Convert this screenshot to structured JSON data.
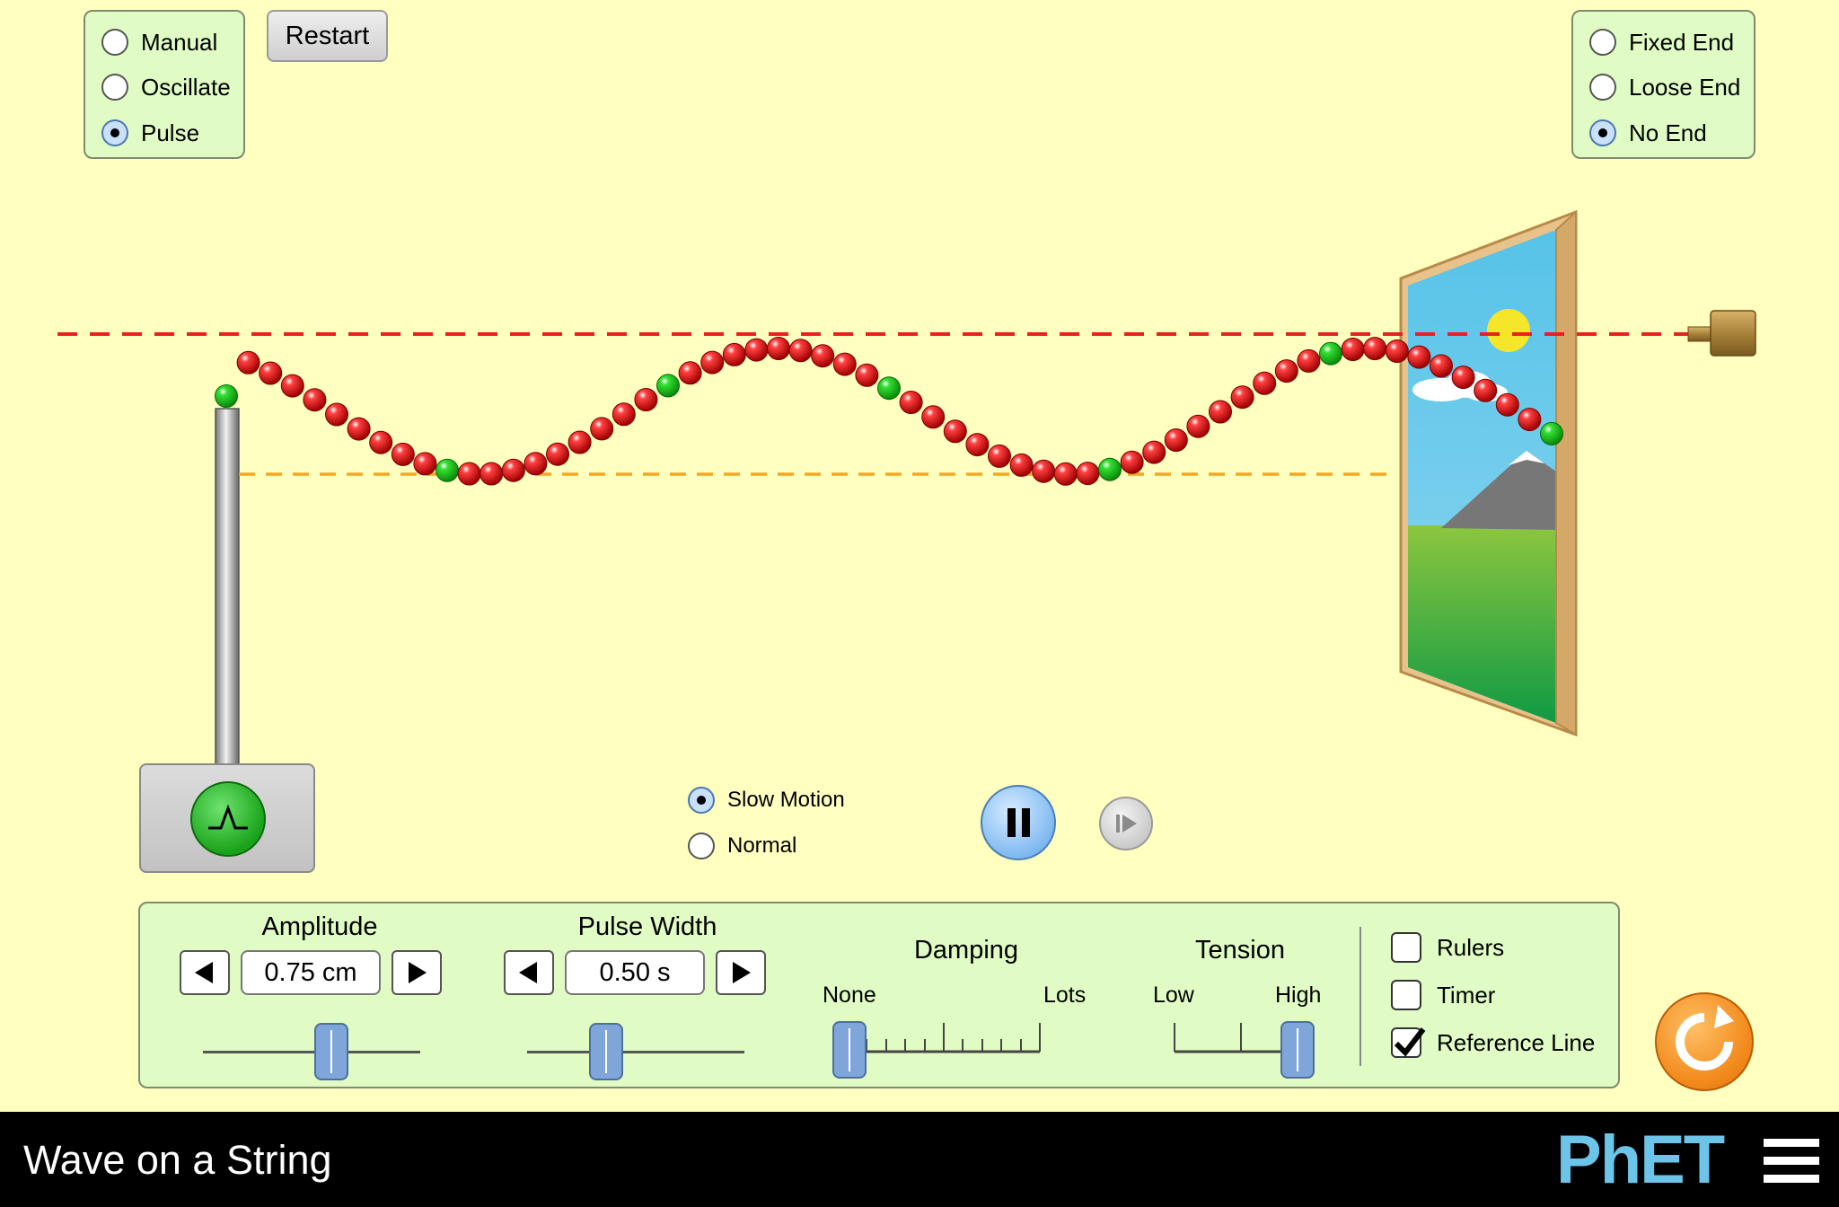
{
  "mode_panel": {
    "options": [
      {
        "label": "Manual",
        "selected": false
      },
      {
        "label": "Oscillate",
        "selected": false
      },
      {
        "label": "Pulse",
        "selected": true
      }
    ]
  },
  "restart_label": "Restart",
  "end_panel": {
    "options": [
      {
        "label": "Fixed End",
        "selected": false
      },
      {
        "label": "Loose End",
        "selected": false
      },
      {
        "label": "No End",
        "selected": true
      }
    ]
  },
  "speed_panel": {
    "options": [
      {
        "label": "Slow Motion",
        "selected": true
      },
      {
        "label": "Normal",
        "selected": false
      }
    ]
  },
  "controls": {
    "amplitude": {
      "label": "Amplitude",
      "value": "0.75 cm"
    },
    "pulse_width": {
      "label": "Pulse Width",
      "value": "0.50 s"
    },
    "damping": {
      "label": "Damping",
      "min_label": "None",
      "max_label": "Lots"
    },
    "tension": {
      "label": "Tension",
      "min_label": "Low",
      "max_label": "High"
    }
  },
  "checkboxes": [
    {
      "label": "Rulers",
      "checked": false
    },
    {
      "label": "Timer",
      "checked": false
    },
    {
      "label": "Reference Line",
      "checked": true
    }
  ],
  "title": "Wave on a String",
  "brand": "PhET",
  "colors": {
    "background": "#ffffc0",
    "panel": "#e0fcc4",
    "bead": "#e80000",
    "bead_marked": "#22cc22",
    "reference_line": "#e82020",
    "orange_line": "#f5a623",
    "reset_button": "#f28a1c",
    "phet_blue": "#6cc4e8"
  },
  "icons": {
    "pulse_button": "pulse-icon",
    "play_pause": "pause-icon",
    "step": "step-forward-icon",
    "reset_all": "reset-all-icon",
    "menu": "hamburger-menu-icon"
  }
}
